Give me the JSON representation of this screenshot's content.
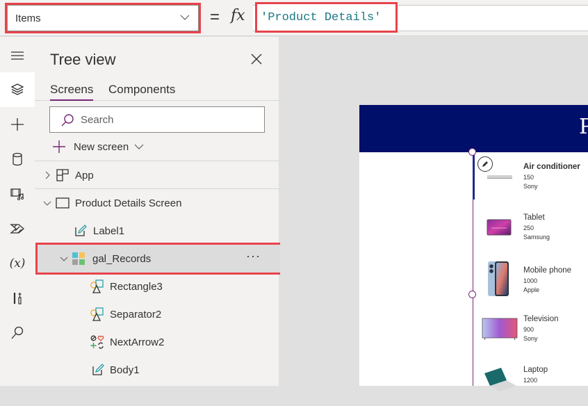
{
  "formula_bar": {
    "property": "Items",
    "equals": "=",
    "fx": "fx",
    "formula": "'Product Details'"
  },
  "rail": {
    "items": [
      {
        "icon": "hamburger-menu-icon",
        "active": false
      },
      {
        "icon": "layers-icon",
        "active": true
      },
      {
        "icon": "plus-icon",
        "active": false
      },
      {
        "icon": "database-icon",
        "active": false
      },
      {
        "icon": "media-icon",
        "active": false
      },
      {
        "icon": "power-automate-icon",
        "active": false
      },
      {
        "icon": "variables-icon",
        "active": false
      },
      {
        "icon": "tools-icon",
        "active": false
      },
      {
        "icon": "search-icon",
        "active": false
      }
    ],
    "variables_label": "(x)"
  },
  "tree_view": {
    "title": "Tree view",
    "tabs": [
      {
        "label": "Screens",
        "active": true
      },
      {
        "label": "Components",
        "active": false
      }
    ],
    "search_placeholder": "Search",
    "new_screen_label": "New screen",
    "nodes": [
      {
        "label": "App",
        "icon": "app-icon",
        "expanded": false
      },
      {
        "label": "Product Details Screen",
        "icon": "screen-icon",
        "expanded": true
      },
      {
        "label": "Label1",
        "icon": "label-edit-icon"
      },
      {
        "label": "gal_Records",
        "icon": "gallery-icon",
        "expanded": true,
        "selected": true,
        "more": "···"
      },
      {
        "label": "Rectangle3",
        "icon": "shapes-icon"
      },
      {
        "label": "Separator2",
        "icon": "shapes-icon"
      },
      {
        "label": "NextArrow2",
        "icon": "icons-control-icon"
      },
      {
        "label": "Body1",
        "icon": "label-edit-icon"
      }
    ]
  },
  "canvas": {
    "header_title": "Product Details",
    "header_color": "#000f6a",
    "gallery_items": [
      {
        "title": "Air conditioner",
        "price": "150",
        "brand": "Sony",
        "image": "air-conditioner-image"
      },
      {
        "title": "Tablet",
        "price": "250",
        "brand": "Samsung",
        "image": "tablet-image"
      },
      {
        "title": "Mobile phone",
        "price": "1000",
        "brand": "Apple",
        "image": "mobile-phone-image"
      },
      {
        "title": "Television",
        "price": "900",
        "brand": "Sony",
        "image": "television-image"
      },
      {
        "title": "Laptop",
        "price": "1200",
        "brand": "",
        "image": "laptop-image"
      }
    ]
  },
  "colors": {
    "accent": "#742774",
    "highlight": "#e8434b",
    "formula_text": "#1a7a85"
  }
}
